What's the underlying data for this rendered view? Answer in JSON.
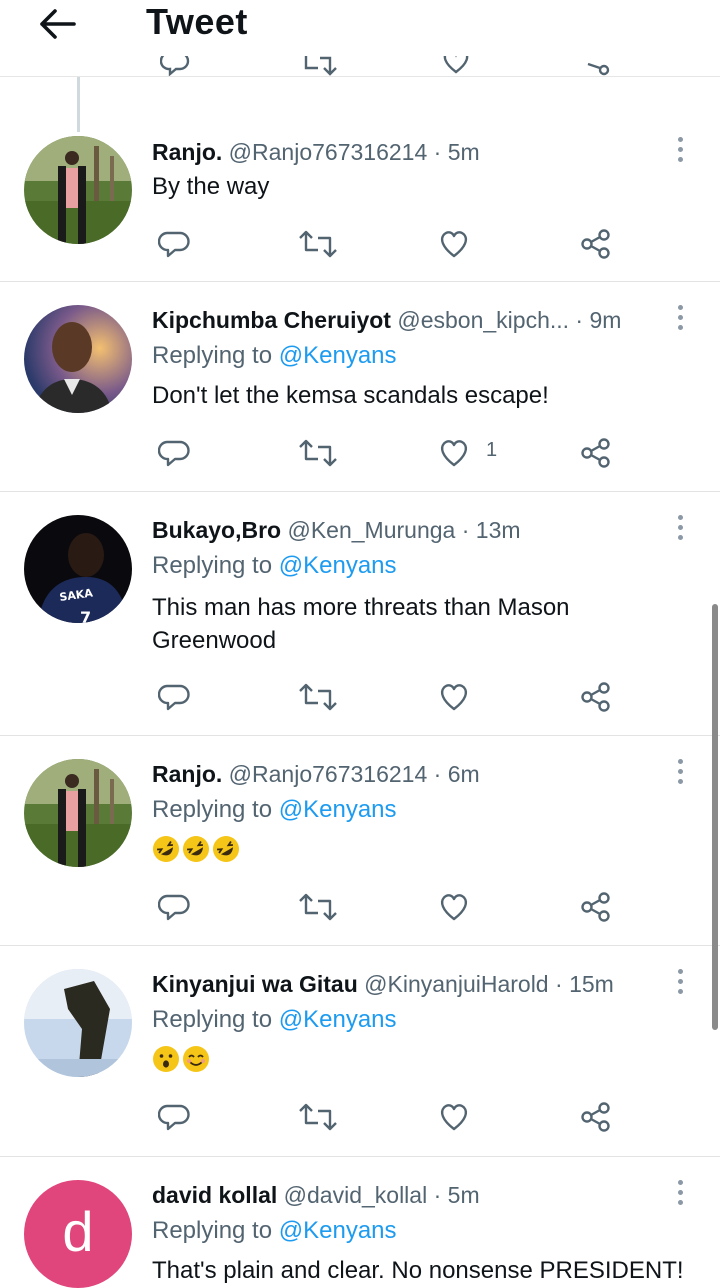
{
  "header": {
    "title": "Tweet",
    "back_icon": "arrow-left-icon"
  },
  "mention_prefix": "Replying to",
  "tweets": [
    {
      "name": "Ranjo.",
      "handle": "@Ranjo767316214",
      "time": "5m",
      "replying_to": "",
      "text": "By the way",
      "likes": ""
    },
    {
      "name": "Kipchumba Cheruiyot",
      "handle": "@esbon_kipch...",
      "time": "9m",
      "replying_to": "@Kenyans",
      "text": "Don't let the kemsa scandals escape!",
      "likes": "1"
    },
    {
      "name": "Bukayo,Bro",
      "handle": "@Ken_Murunga",
      "time": "13m",
      "replying_to": "@Kenyans",
      "text": "This man has more threats than Mason Greenwood",
      "likes": ""
    },
    {
      "name": "Ranjo.",
      "handle": "@Ranjo767316214",
      "time": "6m",
      "replying_to": "@Kenyans",
      "text": "",
      "emojis": [
        "rolling-on-floor-laughing",
        "rolling-on-floor-laughing",
        "rolling-on-floor-laughing"
      ],
      "likes": ""
    },
    {
      "name": "Kinyanjui wa Gitau",
      "handle": "@KinyanjuiHarold",
      "time": "15m",
      "replying_to": "@Kenyans",
      "text": "",
      "emojis": [
        "hushed-face",
        "smiling-face"
      ],
      "likes": ""
    },
    {
      "name": "david kollal",
      "handle": "@david_kollal",
      "time": "5m",
      "replying_to": "@Kenyans",
      "text": "That's plain and clear. No nonsense PRESIDENT!",
      "likes": "",
      "avatar_letter": "d"
    }
  ],
  "colors": {
    "link": "#1d9bf0",
    "muted": "#536471",
    "text": "#0f1419",
    "avatar_pink": "#e0457b"
  },
  "icons": [
    "reply-icon",
    "retweet-icon",
    "like-icon",
    "share-icon",
    "more-options-icon"
  ]
}
